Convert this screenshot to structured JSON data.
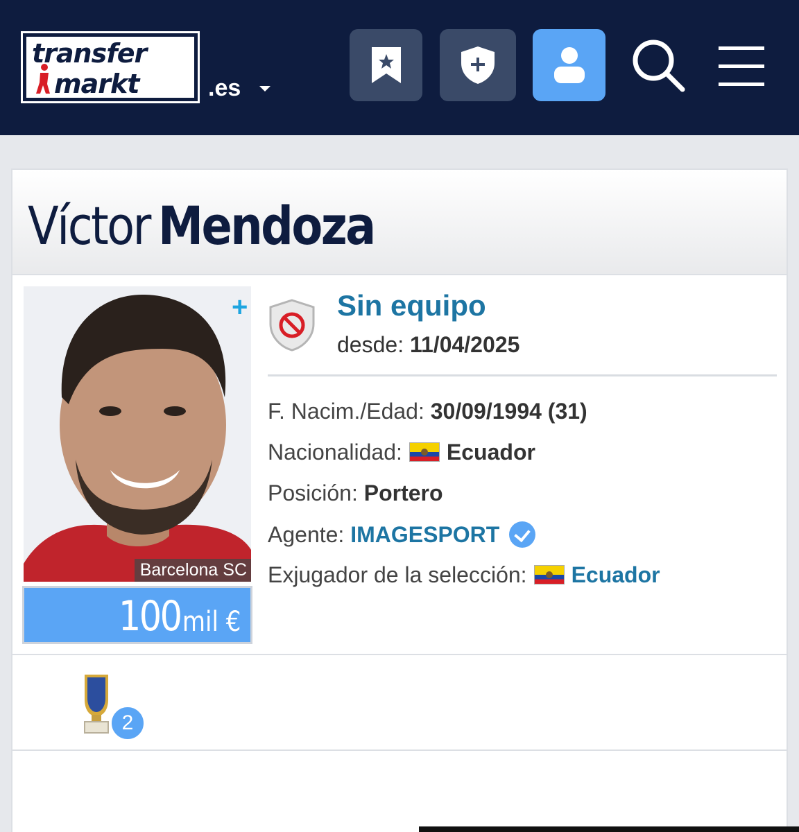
{
  "header": {
    "logo_line1": "transfer",
    "logo_line2": "markt",
    "domain": ".es",
    "buttons": {
      "watchlist_icon": "bookmark-star-icon",
      "club_icon": "shield-plus-icon",
      "profile_icon": "user-icon",
      "search_icon": "search-icon",
      "menu_icon": "hamburger-menu-icon"
    },
    "colors": {
      "background": "#0e1c3f",
      "button": "#3a4a68",
      "active_button": "#5aa5f5"
    }
  },
  "player": {
    "first_name": "Víctor",
    "last_name": "Mendoza",
    "photo_club_label": "Barcelona SC",
    "market_value_number": "100",
    "market_value_unit": "mil €",
    "club": "Sin equipo",
    "since_label": "desde:",
    "since_date": "11/04/2025",
    "details": {
      "birth_label": "F. Nacim./Edad:",
      "birth_value": "30/09/1994 (31)",
      "nationality_label": "Nacionalidad:",
      "nationality_value": "Ecuador",
      "position_label": "Posición:",
      "position_value": "Portero",
      "agent_label": "Agente:",
      "agent_value": "IMAGESPORT",
      "national_team_label": "Exjugador de la selección:",
      "national_team_value": "Ecuador"
    },
    "trophy_count": "2"
  },
  "colors": {
    "link": "#1d75a3",
    "value_box": "#5aa5f5"
  }
}
